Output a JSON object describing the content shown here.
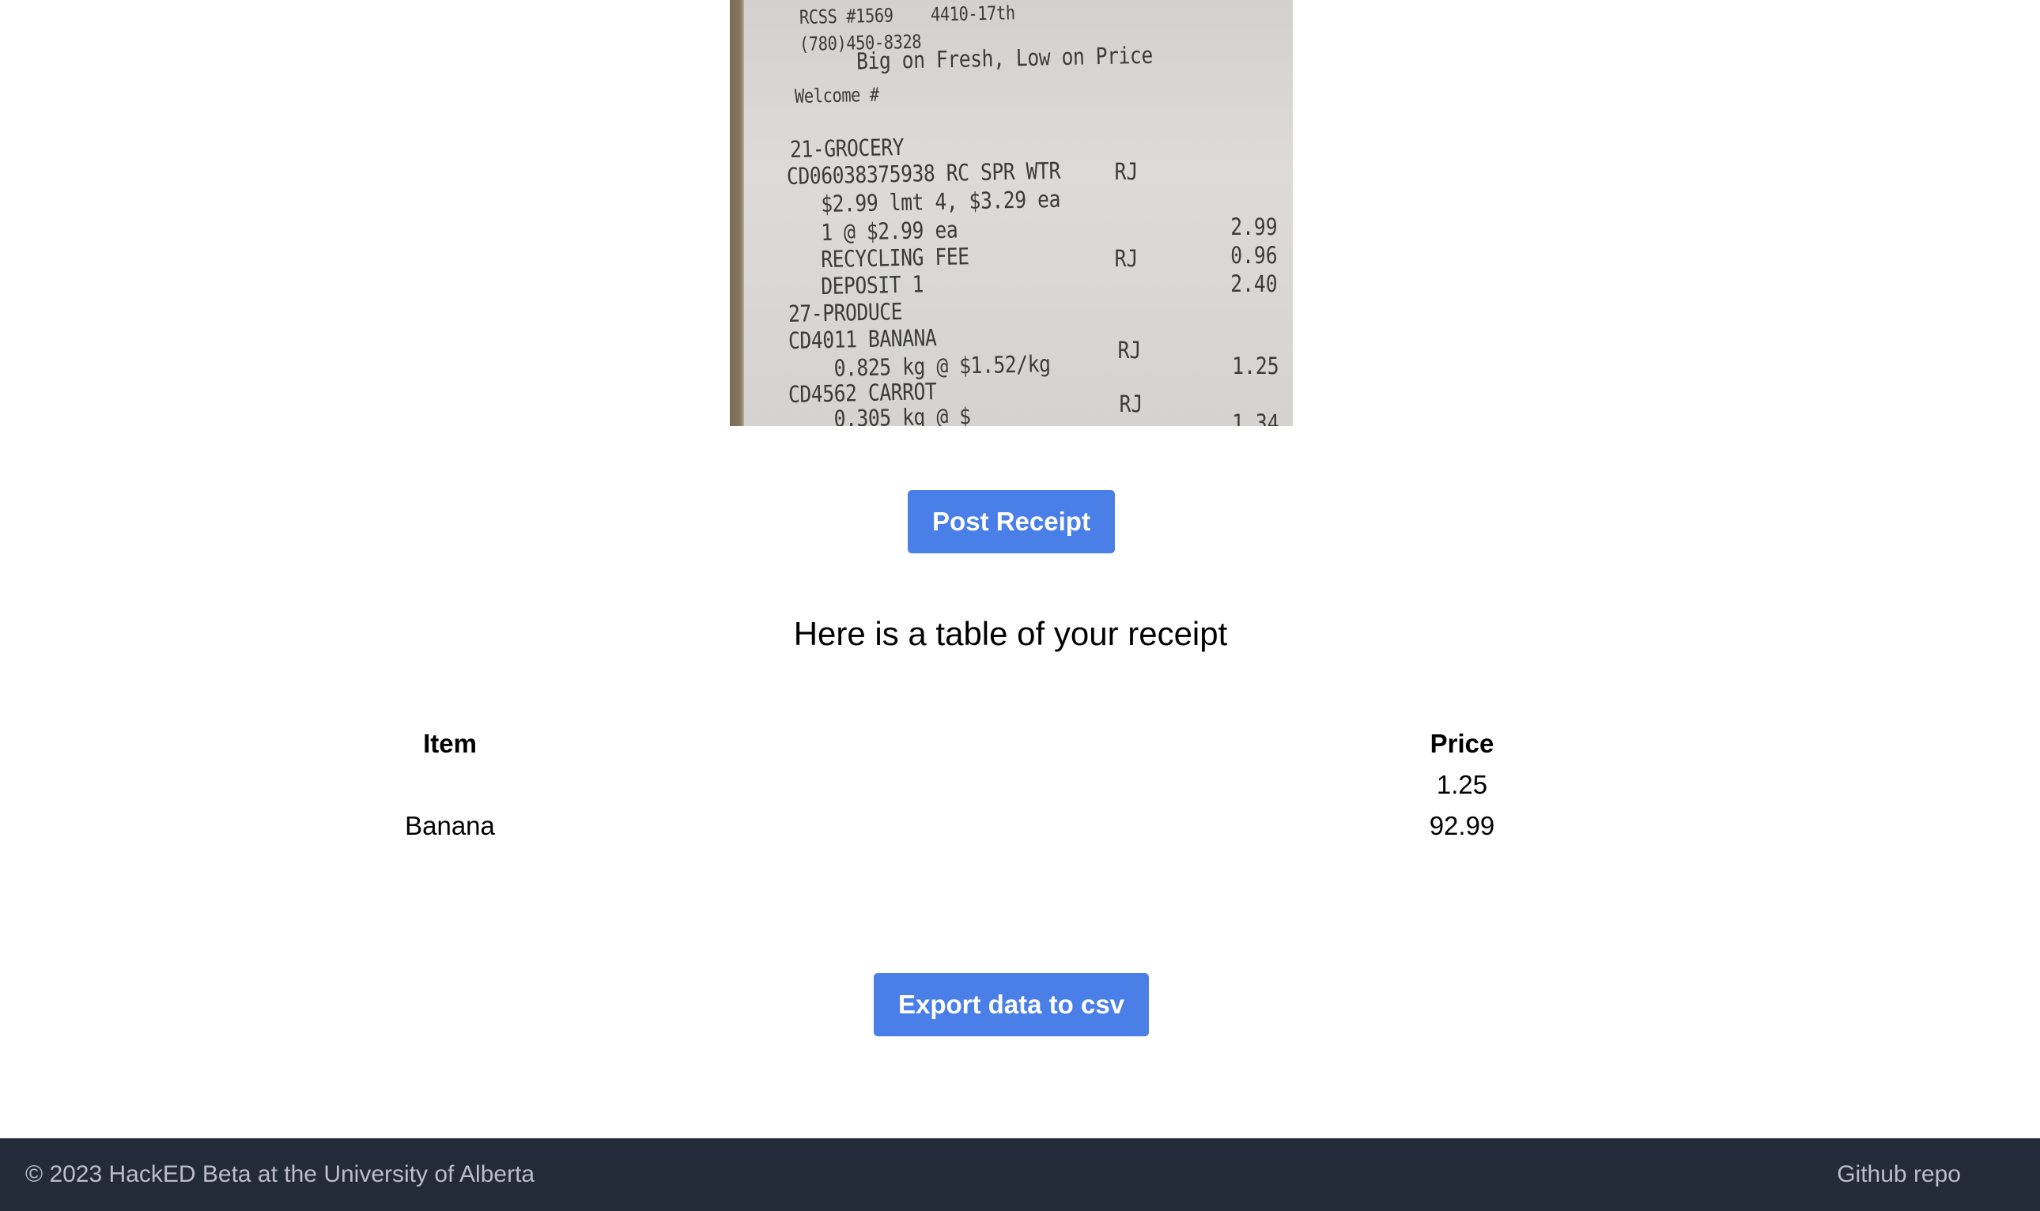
{
  "receipt_image": {
    "lines": [
      "RCSS #1569    4410-17th",
      "(780)450-8328",
      "     Big on Fresh, Low on Price",
      "Welcome #",
      "21-GROCERY",
      "CD06038375938 RC SPR WTR",
      "   $2.99 lmt 4, $3.29 ea",
      "   1 @ $2.99 ea",
      "   RECYCLING FEE",
      "   DEPOSIT 1",
      "27-PRODUCE",
      "CD4011 BANANA",
      "    0.825 kg @ $1.52/kg",
      "CD4562 CARROT",
      "    0.305 kg @ $"
    ],
    "flags": [
      "RJ",
      "RJ",
      "RJ",
      "RJ"
    ],
    "amounts": [
      "2.99",
      "0.96",
      "2.40",
      "1.25",
      "1.34"
    ]
  },
  "post_button": {
    "label": "Post Receipt"
  },
  "heading": "Here is a table of your receipt",
  "table": {
    "headers": {
      "item": "Item",
      "price": "Price"
    },
    "rows": [
      {
        "item": "",
        "price": "1.25"
      },
      {
        "item": "Banana",
        "price": "92.99"
      }
    ]
  },
  "export_button": {
    "label": "Export data to csv"
  },
  "footer": {
    "copyright": "© 2023 HackED Beta at the University of Alberta",
    "github_link": "Github repo"
  }
}
